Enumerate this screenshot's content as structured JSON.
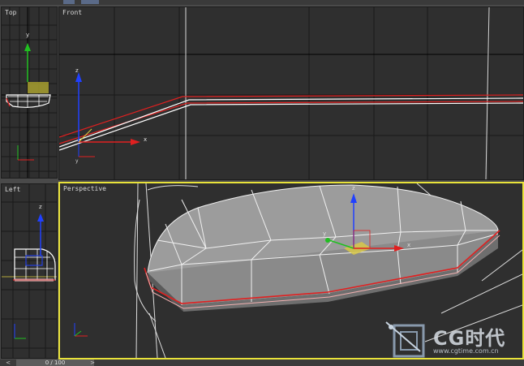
{
  "viewports": {
    "top": {
      "label": "Top"
    },
    "front": {
      "label": "Front"
    },
    "left": {
      "label": "Left"
    },
    "perspective": {
      "label": "Perspective"
    }
  },
  "axes": {
    "x": "x",
    "y": "y",
    "z": "z"
  },
  "timeline": {
    "frame_counter": "0 / 100",
    "prev_arrow": "<",
    "next_arrow": ">"
  },
  "watermark": {
    "logo_text": "CG时代",
    "url": "www.cgtime.com.cn",
    "icon": "cg-logo-icon"
  },
  "colors": {
    "viewport_bg": "#2f2f2f",
    "active_border": "#e8e23a",
    "grid": "#1a1a1a",
    "edge_red": "#e02020",
    "mesh_white": "#ffffff",
    "axis_x": "#e02020",
    "axis_y": "#20c020",
    "axis_z": "#2040ff"
  }
}
